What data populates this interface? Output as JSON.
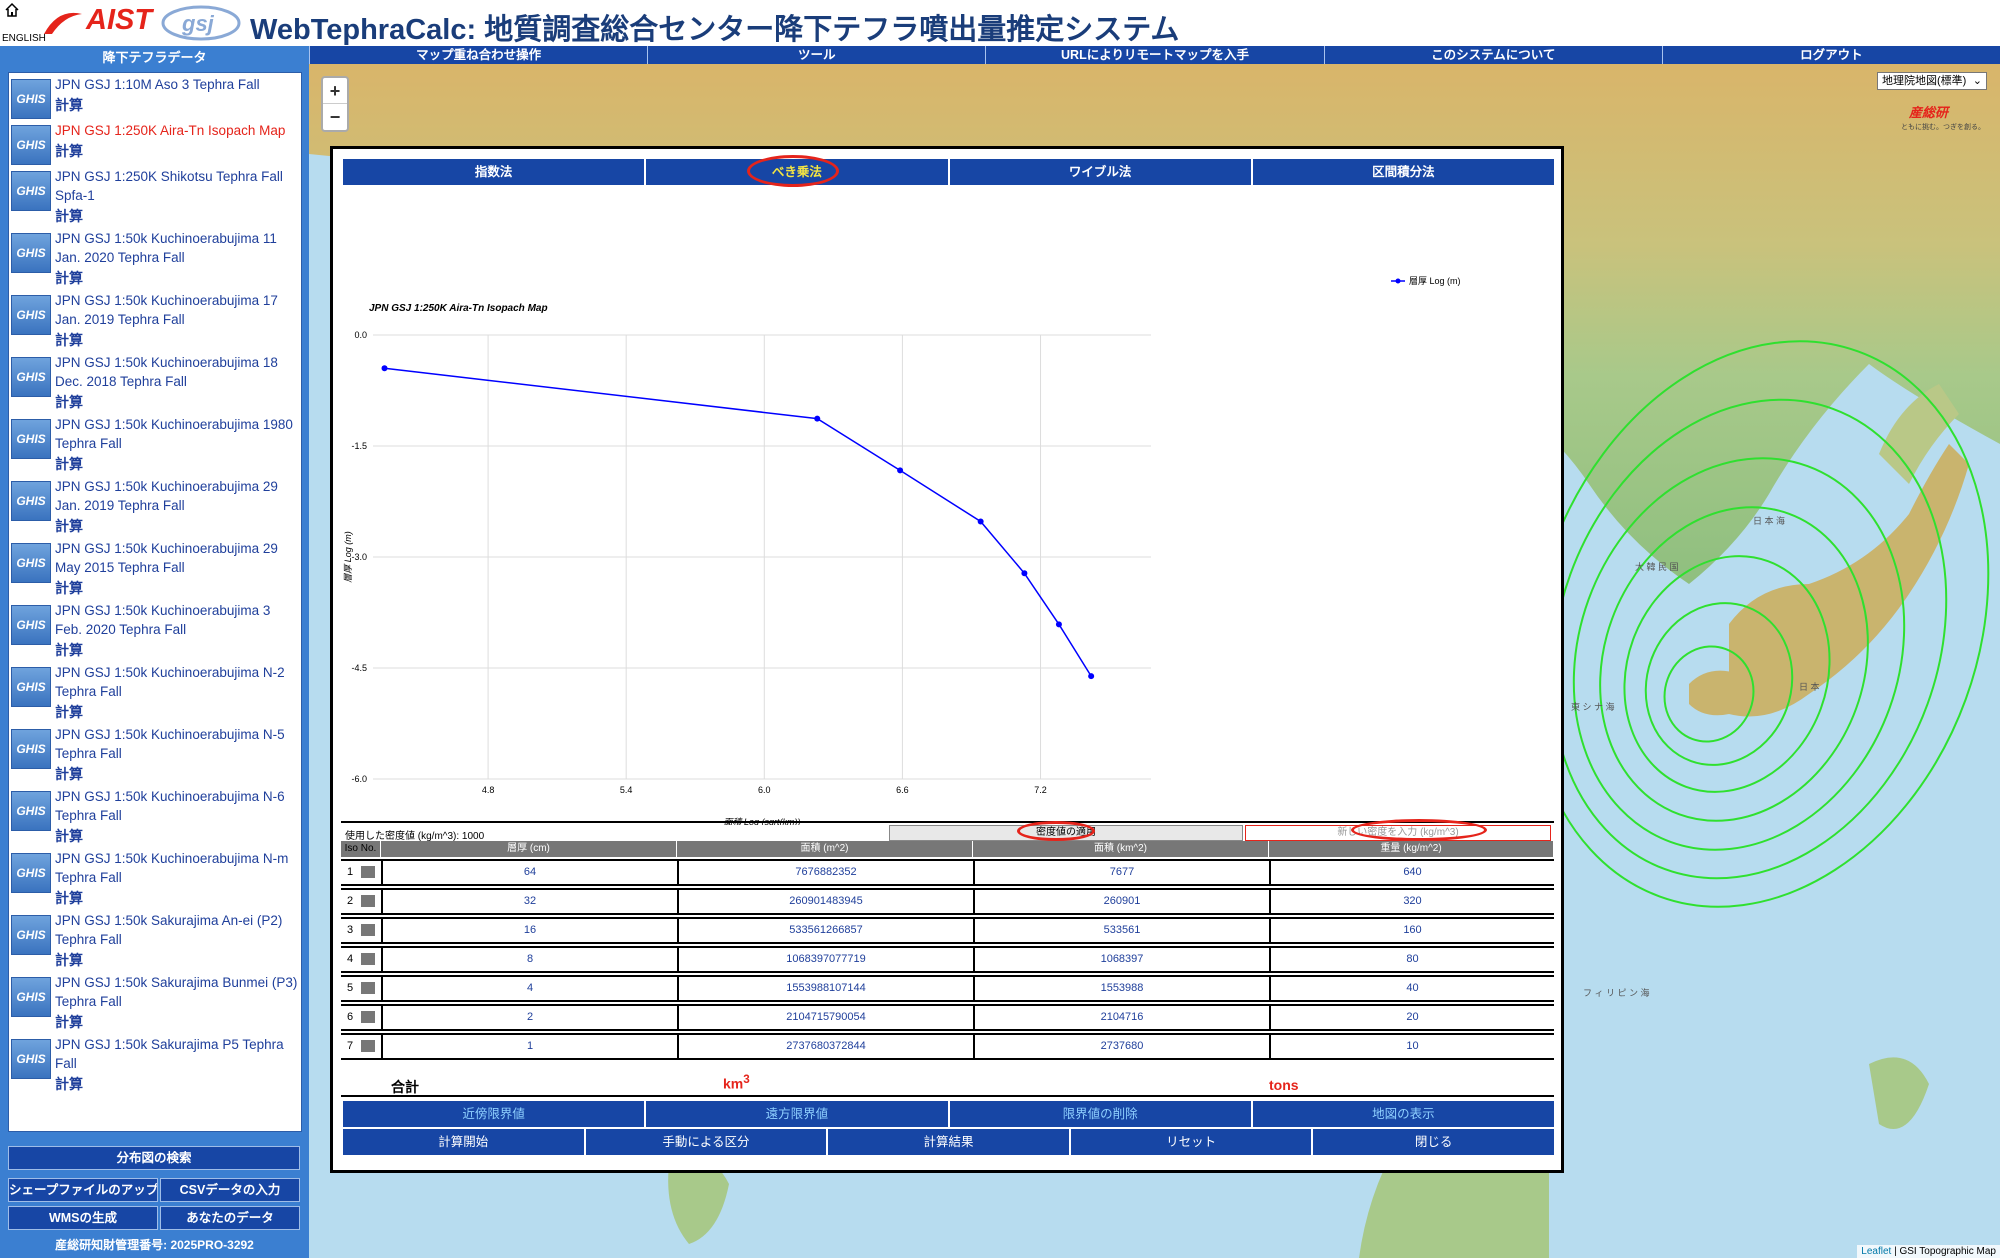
{
  "header": {
    "english": "ENGLISH",
    "aist": "AIST",
    "title": "WebTephraCalc: 地質調査総合センター降下テフラ噴出量推定システム"
  },
  "sidebar": {
    "title": "降下テフラデータ",
    "ghis": "GHIS",
    "calc": "計算",
    "items": [
      {
        "name": "JPN GSJ 1:10M Aso 3 Tephra Fall"
      },
      {
        "name": "JPN GSJ 1:250K Aira-Tn Isopach Map"
      },
      {
        "name": "JPN GSJ 1:250K Shikotsu Tephra Fall Spfa-1"
      },
      {
        "name": "JPN GSJ 1:50k Kuchinoerabujima 11 Jan. 2020 Tephra Fall"
      },
      {
        "name": "JPN GSJ 1:50k Kuchinoerabujima 17 Jan. 2019 Tephra Fall"
      },
      {
        "name": "JPN GSJ 1:50k Kuchinoerabujima 18 Dec. 2018 Tephra Fall"
      },
      {
        "name": "JPN GSJ 1:50k Kuchinoerabujima 1980 Tephra Fall"
      },
      {
        "name": "JPN GSJ 1:50k Kuchinoerabujima 29 Jan. 2019 Tephra Fall"
      },
      {
        "name": "JPN GSJ 1:50k Kuchinoerabujima 29 May 2015 Tephra Fall"
      },
      {
        "name": "JPN GSJ 1:50k Kuchinoerabujima 3 Feb. 2020 Tephra Fall"
      },
      {
        "name": "JPN GSJ 1:50k Kuchinoerabujima N-2 Tephra Fall"
      },
      {
        "name": "JPN GSJ 1:50k Kuchinoerabujima N-5 Tephra Fall"
      },
      {
        "name": "JPN GSJ 1:50k Kuchinoerabujima N-6 Tephra Fall"
      },
      {
        "name": "JPN GSJ 1:50k Kuchinoerabujima N-m Tephra Fall"
      },
      {
        "name": "JPN GSJ 1:50k Sakurajima An-ei (P2) Tephra Fall"
      },
      {
        "name": "JPN GSJ 1:50k Sakurajima Bunmei (P3) Tephra Fall"
      },
      {
        "name": "JPN GSJ 1:50k Sakurajima P5 Tephra Fall"
      }
    ],
    "search_btn": "分布図の検索",
    "shape_btn": "シェープファイルのアップ",
    "csv_btn": "CSVデータの入力",
    "wms_btn": "WMSの生成",
    "your_data_btn": "あなたのデータ",
    "footer": "産総研知財管理番号: 2025PRO-3292"
  },
  "menu": [
    "マップ重ね合わせ操作",
    "ツール",
    "URLによりリモートマップを入手",
    "このシステムについて",
    "ログアウト"
  ],
  "map": {
    "zoom_in": "+",
    "zoom_out": "−",
    "layer": "地理院地図(標準)",
    "corner_logo": "産総研",
    "corner_sub": "ともに挑む。つぎを創る。",
    "attrib_leaflet": "Leaflet",
    "attrib_rest": " | GSI Topographic Map",
    "labels": [
      "日 本 海",
      "日 本",
      "東 シ ナ 海",
      "フ ィ リ ピ ン 海",
      "大 韓 民 国"
    ]
  },
  "dialog": {
    "tabs": [
      "指数法",
      "べき乗法",
      "ワイブル法",
      "区間積分法"
    ],
    "density_label": "使用した密度値 (kg/m^3): 1000",
    "density_apply": "密度値の適用",
    "density_placeholder": "新しい密度を入力 (kg/m^3)",
    "table_headers": [
      "Iso No.",
      "層厚 (cm)",
      "面積 (m^2)",
      "面積 (km^2)",
      "重量 (kg/m^2)"
    ],
    "rows": [
      {
        "no": "1",
        "thick": "64",
        "area_m2": "7676882352",
        "area_km2": "7677",
        "weight": "640"
      },
      {
        "no": "2",
        "thick": "32",
        "area_m2": "260901483945",
        "area_km2": "260901",
        "weight": "320"
      },
      {
        "no": "3",
        "thick": "16",
        "area_m2": "533561266857",
        "area_km2": "533561",
        "weight": "160"
      },
      {
        "no": "4",
        "thick": "8",
        "area_m2": "1068397077719",
        "area_km2": "1068397",
        "weight": "80"
      },
      {
        "no": "5",
        "thick": "4",
        "area_m2": "1553988107144",
        "area_km2": "1553988",
        "weight": "40"
      },
      {
        "no": "6",
        "thick": "2",
        "area_m2": "2104715790054",
        "area_km2": "2104716",
        "weight": "20"
      },
      {
        "no": "7",
        "thick": "1",
        "area_m2": "2737680372844",
        "area_km2": "2737680",
        "weight": "10"
      }
    ],
    "total_label": "合計",
    "total_km": "km",
    "total_km_sup": "3",
    "total_tons": "tons",
    "buttons_row1": [
      "近傍限界値",
      "遠方限界値",
      "限界値の削除",
      "地図の表示"
    ],
    "buttons_row2": [
      "計算開始",
      "手動による区分",
      "計算結果",
      "リセット",
      "閉じる"
    ]
  },
  "chart_data": {
    "type": "line",
    "title": "JPN GSJ 1:250K Aira-Tn Isopach Map",
    "xlabel": "面積 Log (sqrt(km))",
    "ylabel": "層厚 Log (m)",
    "xlim": [
      4.3,
      7.68
    ],
    "ylim": [
      -6.0,
      0.0
    ],
    "xticks": [
      "4.8",
      "5.4",
      "6.0",
      "6.6",
      "7.2"
    ],
    "yticks": [
      "0.0",
      "-1.5",
      "-3.0",
      "-4.5",
      "-6.0"
    ],
    "legend": "top-right",
    "series": [
      {
        "name": "層厚 Log (m)",
        "color": "#0000ff",
        "x": [
          4.35,
          6.23,
          6.59,
          6.94,
          7.13,
          7.28,
          7.42
        ],
        "y": [
          -0.45,
          -1.13,
          -1.83,
          -2.52,
          -3.22,
          -3.91,
          -4.61
        ]
      }
    ]
  }
}
